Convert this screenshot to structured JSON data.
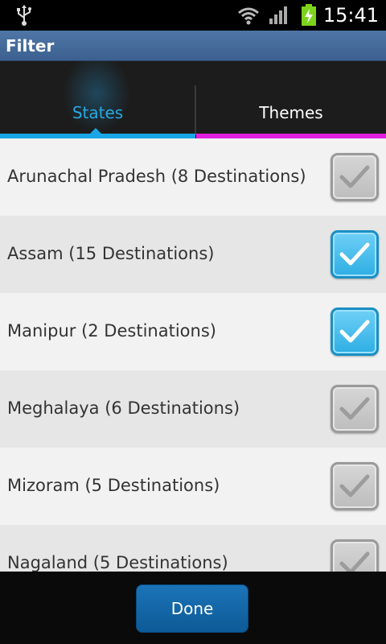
{
  "status_bar": {
    "time": "15:41",
    "icons": [
      "usb-icon",
      "wifi-icon",
      "signal-icon",
      "battery-charging-icon"
    ]
  },
  "title_bar": {
    "title": "Filter"
  },
  "tabs": [
    {
      "label": "States",
      "selected": true,
      "accent": "#18a6e6"
    },
    {
      "label": "Themes",
      "selected": false,
      "accent": "#e11fe0"
    }
  ],
  "list": {
    "items": [
      {
        "label": "Arunachal Pradesh (8 Destinations)",
        "checked": false
      },
      {
        "label": "Assam (15 Destinations)",
        "checked": true
      },
      {
        "label": "Manipur (2 Destinations)",
        "checked": true
      },
      {
        "label": "Meghalaya (6 Destinations)",
        "checked": false
      },
      {
        "label": "Mizoram (5 Destinations)",
        "checked": false
      },
      {
        "label": "Nagaland (5 Destinations)",
        "checked": false
      }
    ]
  },
  "footer": {
    "done_label": "Done"
  },
  "colors": {
    "accent_blue": "#18a6e6",
    "accent_magenta": "#e11fe0",
    "button_blue": "#1b74b8"
  }
}
